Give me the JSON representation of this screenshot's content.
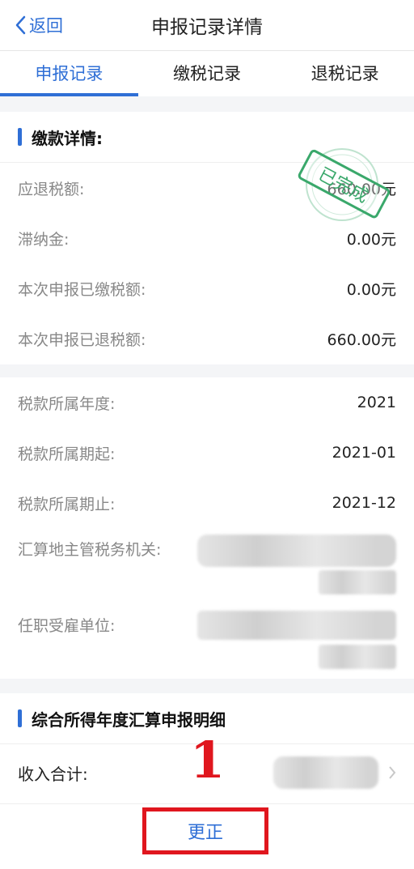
{
  "header": {
    "back_label": "返回",
    "title": "申报记录详情"
  },
  "tabs": [
    {
      "label": "申报记录",
      "active": true
    },
    {
      "label": "缴税记录",
      "active": false
    },
    {
      "label": "退税记录",
      "active": false
    }
  ],
  "payment": {
    "title": "缴款详情:",
    "rows": [
      {
        "label": "应退税额:",
        "value": "660.00元"
      },
      {
        "label": "滞纳金:",
        "value": "0.00元"
      },
      {
        "label": "本次申报已缴税额:",
        "value": "0.00元"
      },
      {
        "label": "本次申报已退税额:",
        "value": "660.00元"
      }
    ],
    "stamp_text": "已完成"
  },
  "tax_info": {
    "rows": [
      {
        "label": "税款所属年度:",
        "value": "2021"
      },
      {
        "label": "税款所属期起:",
        "value": "2021-01"
      },
      {
        "label": "税款所属期止:",
        "value": "2021-12"
      },
      {
        "label": "汇算地主管税务机关:",
        "value": ""
      },
      {
        "label": "任职受雇单位:",
        "value": ""
      }
    ]
  },
  "detail": {
    "title": "综合所得年度汇算申报明细",
    "income_label": "收入合计:"
  },
  "annotation": "1",
  "footer": {
    "correct_label": "更正"
  },
  "colors": {
    "accent": "#2f6fd6",
    "annotation": "#e0161e",
    "stamp": "#3aa86b"
  }
}
